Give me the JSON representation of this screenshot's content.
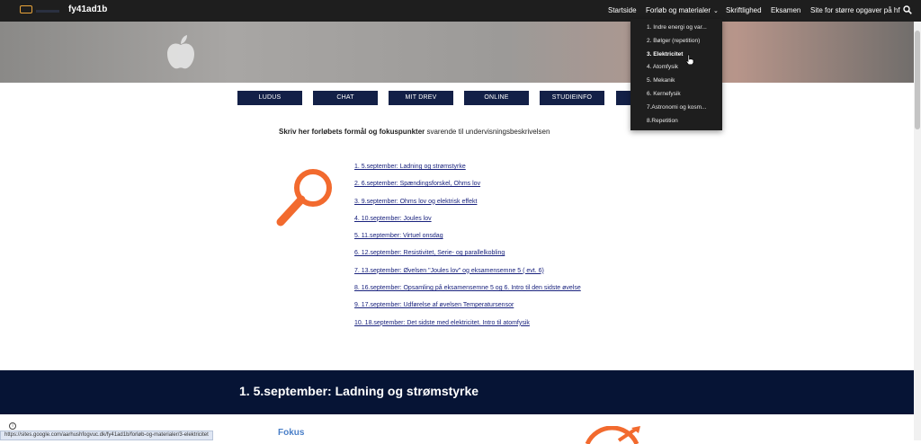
{
  "header": {
    "site_title": "fy41ad1b",
    "nav": [
      {
        "label": "Startside"
      },
      {
        "label": "Forløb og materialer",
        "chevron": "chevron-down-icon"
      },
      {
        "label": "Skriftlighed"
      },
      {
        "label": "Eksamen"
      },
      {
        "label": "Site for større opgaver på hf"
      }
    ]
  },
  "dropdown": {
    "items": [
      {
        "label": "1. Indre energi og var..."
      },
      {
        "label": "2. Bølger (repetition)"
      },
      {
        "label": "3. Elektricitet",
        "current": true
      },
      {
        "label": "4. Atomfysik"
      },
      {
        "label": "5. Mekanik"
      },
      {
        "label": "6. Kernefysik"
      },
      {
        "label": "7.Astronomi og kosm..."
      },
      {
        "label": "8.Repetition"
      }
    ]
  },
  "buttons": [
    "LUDUS",
    "CHAT",
    "MIT DREV",
    "ONLINE",
    "STUDIEINFO",
    ""
  ],
  "intro": {
    "bold": "Skriv her forløbets formål og fokuspunkter",
    "rest": " svarende til undervisningsbeskrivelsen"
  },
  "links": [
    "1. 5.september: Ladning og strømstyrke",
    "2. 6.september: Spændingsforskel, Ohms lov",
    "3. 9.september: Ohms lov og elektrisk effekt",
    "4. 10.september: Joules lov",
    "5. 11.september: Virtuel onsdag",
    "6. 12.september: Resistivitet, Serie- og parallelkobling",
    "7. 13.september: Øvelsen \"Joules lov\" og eksamensemne 5 ( evt. 6)",
    "8. 16.september: Opsamling på eksamensemne 5 og 6. Intro til den sidste øvelse",
    "9. 17.september: Udførelse af øvelsen Temperatursensor",
    "10. 18.september: Det sidste med elektricitet. Intro til atomfysik"
  ],
  "section": {
    "title": "1. 5.september: Ladning og strømstyrke",
    "subheading": "Fokus"
  },
  "status_url": "https://sites.google.com/aarhushfogvuc.dk/fy41ad1b/forløb-og-materialer/3-elektricitet",
  "colors": {
    "topbar": "#1e1e1e",
    "button": "#132047",
    "band": "#061435",
    "accent_orange": "#f26a2e",
    "link": "#1a237e"
  }
}
